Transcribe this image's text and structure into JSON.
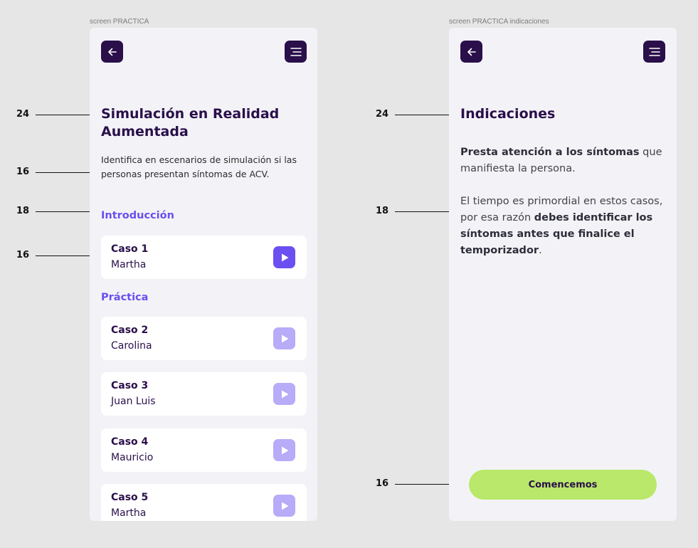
{
  "left_frame": {
    "label": "screen PRACTICA",
    "title": "Simulación en Realidad Aumentada",
    "description": "Identifica en escenarios de simulación si las personas presentan síntomas de ACV.",
    "intro_label": "Introducción",
    "practice_label": "Práctica",
    "intro_cases": [
      {
        "title": "Caso 1",
        "name": "Martha",
        "state": "active"
      }
    ],
    "practice_cases": [
      {
        "title": "Caso 2",
        "name": "Carolina",
        "state": "inactive"
      },
      {
        "title": "Caso 3",
        "name": "Juan Luis",
        "state": "inactive"
      },
      {
        "title": "Caso 4",
        "name": "Mauricio",
        "state": "inactive"
      },
      {
        "title": "Caso 5",
        "name": "Martha",
        "state": "inactive"
      }
    ]
  },
  "right_frame": {
    "label": "screen PRACTICA indicaciones",
    "title": "Indicaciones",
    "para1_bold": "Presta atención a los síntomas",
    "para1_rest": " que manifiesta la persona.",
    "para2_start": "El tiempo es primordial en estos casos, por esa razón ",
    "para2_bold": "debes identificar los síntomas antes que finalice el temporizador",
    "para2_end": ".",
    "cta_label": "Comencemos"
  },
  "annotations_left": [
    "24",
    "16",
    "18",
    "16"
  ],
  "annotations_right": [
    "24",
    "18",
    "16"
  ],
  "icons": {
    "back": "arrow-left-icon",
    "menu": "menu-icon",
    "play": "play-icon"
  },
  "colors": {
    "background": "#e6e6e6",
    "screen": "#f3f3f7",
    "primary_dark": "#2a0f4a",
    "accent": "#6b4ff0",
    "accent_disabled": "#b8abf7",
    "cta": "#b9e86a"
  }
}
